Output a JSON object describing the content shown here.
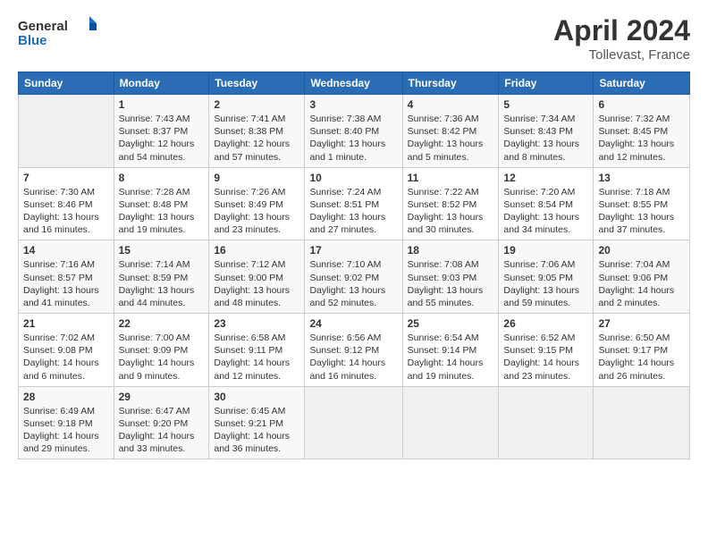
{
  "header": {
    "logo_general": "General",
    "logo_blue": "Blue",
    "month_title": "April 2024",
    "location": "Tollevast, France"
  },
  "weekdays": [
    "Sunday",
    "Monday",
    "Tuesday",
    "Wednesday",
    "Thursday",
    "Friday",
    "Saturday"
  ],
  "weeks": [
    [
      {
        "day": "",
        "info": ""
      },
      {
        "day": "1",
        "info": "Sunrise: 7:43 AM\nSunset: 8:37 PM\nDaylight: 12 hours\nand 54 minutes."
      },
      {
        "day": "2",
        "info": "Sunrise: 7:41 AM\nSunset: 8:38 PM\nDaylight: 12 hours\nand 57 minutes."
      },
      {
        "day": "3",
        "info": "Sunrise: 7:38 AM\nSunset: 8:40 PM\nDaylight: 13 hours\nand 1 minute."
      },
      {
        "day": "4",
        "info": "Sunrise: 7:36 AM\nSunset: 8:42 PM\nDaylight: 13 hours\nand 5 minutes."
      },
      {
        "day": "5",
        "info": "Sunrise: 7:34 AM\nSunset: 8:43 PM\nDaylight: 13 hours\nand 8 minutes."
      },
      {
        "day": "6",
        "info": "Sunrise: 7:32 AM\nSunset: 8:45 PM\nDaylight: 13 hours\nand 12 minutes."
      }
    ],
    [
      {
        "day": "7",
        "info": "Sunrise: 7:30 AM\nSunset: 8:46 PM\nDaylight: 13 hours\nand 16 minutes."
      },
      {
        "day": "8",
        "info": "Sunrise: 7:28 AM\nSunset: 8:48 PM\nDaylight: 13 hours\nand 19 minutes."
      },
      {
        "day": "9",
        "info": "Sunrise: 7:26 AM\nSunset: 8:49 PM\nDaylight: 13 hours\nand 23 minutes."
      },
      {
        "day": "10",
        "info": "Sunrise: 7:24 AM\nSunset: 8:51 PM\nDaylight: 13 hours\nand 27 minutes."
      },
      {
        "day": "11",
        "info": "Sunrise: 7:22 AM\nSunset: 8:52 PM\nDaylight: 13 hours\nand 30 minutes."
      },
      {
        "day": "12",
        "info": "Sunrise: 7:20 AM\nSunset: 8:54 PM\nDaylight: 13 hours\nand 34 minutes."
      },
      {
        "day": "13",
        "info": "Sunrise: 7:18 AM\nSunset: 8:55 PM\nDaylight: 13 hours\nand 37 minutes."
      }
    ],
    [
      {
        "day": "14",
        "info": "Sunrise: 7:16 AM\nSunset: 8:57 PM\nDaylight: 13 hours\nand 41 minutes."
      },
      {
        "day": "15",
        "info": "Sunrise: 7:14 AM\nSunset: 8:59 PM\nDaylight: 13 hours\nand 44 minutes."
      },
      {
        "day": "16",
        "info": "Sunrise: 7:12 AM\nSunset: 9:00 PM\nDaylight: 13 hours\nand 48 minutes."
      },
      {
        "day": "17",
        "info": "Sunrise: 7:10 AM\nSunset: 9:02 PM\nDaylight: 13 hours\nand 52 minutes."
      },
      {
        "day": "18",
        "info": "Sunrise: 7:08 AM\nSunset: 9:03 PM\nDaylight: 13 hours\nand 55 minutes."
      },
      {
        "day": "19",
        "info": "Sunrise: 7:06 AM\nSunset: 9:05 PM\nDaylight: 13 hours\nand 59 minutes."
      },
      {
        "day": "20",
        "info": "Sunrise: 7:04 AM\nSunset: 9:06 PM\nDaylight: 14 hours\nand 2 minutes."
      }
    ],
    [
      {
        "day": "21",
        "info": "Sunrise: 7:02 AM\nSunset: 9:08 PM\nDaylight: 14 hours\nand 6 minutes."
      },
      {
        "day": "22",
        "info": "Sunrise: 7:00 AM\nSunset: 9:09 PM\nDaylight: 14 hours\nand 9 minutes."
      },
      {
        "day": "23",
        "info": "Sunrise: 6:58 AM\nSunset: 9:11 PM\nDaylight: 14 hours\nand 12 minutes."
      },
      {
        "day": "24",
        "info": "Sunrise: 6:56 AM\nSunset: 9:12 PM\nDaylight: 14 hours\nand 16 minutes."
      },
      {
        "day": "25",
        "info": "Sunrise: 6:54 AM\nSunset: 9:14 PM\nDaylight: 14 hours\nand 19 minutes."
      },
      {
        "day": "26",
        "info": "Sunrise: 6:52 AM\nSunset: 9:15 PM\nDaylight: 14 hours\nand 23 minutes."
      },
      {
        "day": "27",
        "info": "Sunrise: 6:50 AM\nSunset: 9:17 PM\nDaylight: 14 hours\nand 26 minutes."
      }
    ],
    [
      {
        "day": "28",
        "info": "Sunrise: 6:49 AM\nSunset: 9:18 PM\nDaylight: 14 hours\nand 29 minutes."
      },
      {
        "day": "29",
        "info": "Sunrise: 6:47 AM\nSunset: 9:20 PM\nDaylight: 14 hours\nand 33 minutes."
      },
      {
        "day": "30",
        "info": "Sunrise: 6:45 AM\nSunset: 9:21 PM\nDaylight: 14 hours\nand 36 minutes."
      },
      {
        "day": "",
        "info": ""
      },
      {
        "day": "",
        "info": ""
      },
      {
        "day": "",
        "info": ""
      },
      {
        "day": "",
        "info": ""
      }
    ]
  ]
}
